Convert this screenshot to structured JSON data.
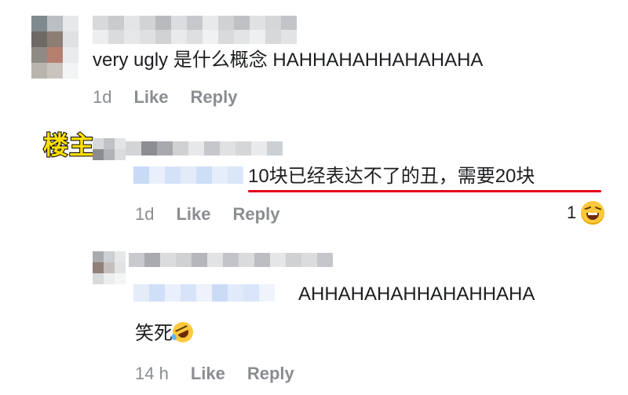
{
  "comments": [
    {
      "text": "very ugly 是什么概念 HAHHAHAHHAHAHAHA",
      "time": "1d",
      "like_label": "Like",
      "reply_label": "Reply"
    },
    {
      "badge": "楼主:",
      "text": "10块已经表达不了的丑，需要20块",
      "time": "1d",
      "like_label": "Like",
      "reply_label": "Reply",
      "reaction_count": "1",
      "reaction_icon": "laughing-emoji-icon"
    },
    {
      "text_line1": "AHHAHAHAHHAHAHHAHA",
      "text_line2": "笑死",
      "emoji_icon": "rofl-emoji-icon",
      "time": "14 h",
      "like_label": "Like",
      "reply_label": "Reply"
    }
  ],
  "colors": {
    "text": "#1c1e21",
    "meta": "#8a8d91",
    "underline": "#e3001b",
    "badge_fill": "#ffde00",
    "badge_stroke": "#000000"
  }
}
